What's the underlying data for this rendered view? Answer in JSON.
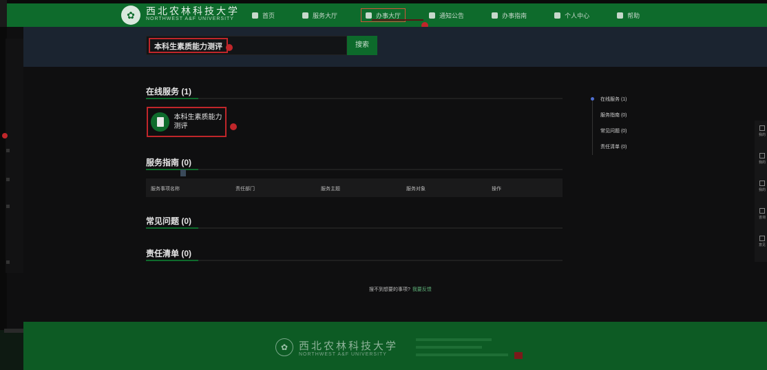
{
  "header": {
    "school_name": "西北农林科技大学",
    "school_name_en": "NORTHWEST A&F UNIVERSITY",
    "nav": [
      {
        "label": "首页",
        "icon": "home-icon"
      },
      {
        "label": "服务大厅",
        "icon": "grid-icon"
      },
      {
        "label": "办事大厅",
        "icon": "doc-icon",
        "active": true
      },
      {
        "label": "通知公告",
        "icon": "bell-icon"
      },
      {
        "label": "办事指南",
        "icon": "book-icon"
      },
      {
        "label": "个人中心",
        "icon": "user-icon"
      },
      {
        "label": "帮助",
        "icon": "help-icon"
      }
    ]
  },
  "search": {
    "value": "本科生素质能力测评",
    "button_label": "搜索"
  },
  "sections": {
    "online": {
      "title": "在线服务 (1)"
    },
    "guide": {
      "title": "服务指南 (0)"
    },
    "faq": {
      "title": "常见问题 (0)"
    },
    "duty": {
      "title": "责任清单 (0)"
    }
  },
  "service_card": {
    "label": "本科生素质能力测评"
  },
  "table": {
    "columns": [
      "服务事项名称",
      "责任部门",
      "服务主题",
      "服务对象",
      "操作"
    ]
  },
  "feedback": {
    "text": "搜不到想要的事项?",
    "link": "我要反馈"
  },
  "toc": [
    {
      "label": "在线服务 (1)",
      "active": true
    },
    {
      "label": "服务指南 (0)"
    },
    {
      "label": "常见问题 (0)"
    },
    {
      "label": "责任清单 (0)"
    }
  ],
  "right_tools": [
    "我的",
    "我的",
    "我的",
    "咨询",
    "意见"
  ],
  "footer": {
    "school_name": "西北农林科技大学",
    "school_name_en": "NORTHWEST A&F UNIVERSITY"
  },
  "colors": {
    "brand_green": "#0e6b2c",
    "annotation_red": "#c0262a",
    "toc_active": "#4f6fd1"
  }
}
